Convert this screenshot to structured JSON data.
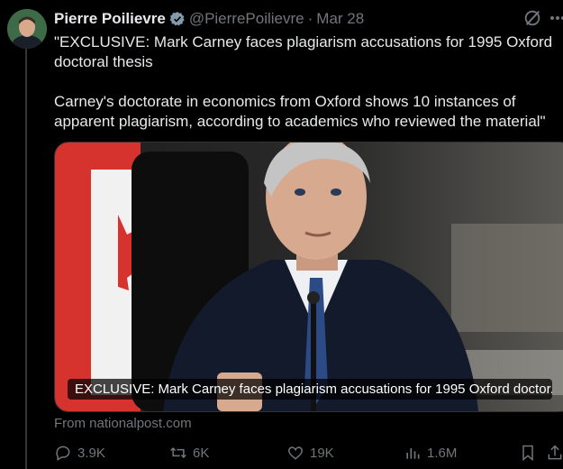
{
  "author": {
    "name": "Pierre Poilievre",
    "handle": "@PierrePoilievre",
    "separator": "·",
    "date": "Mar 28",
    "verified_color": "#829aab"
  },
  "tweet": {
    "paragraphs": [
      "\"EXCLUSIVE: Mark Carney faces plagiarism accusations for 1995 Oxford doctoral thesis",
      "Carney's doctorate in economics from Oxford shows 10 instances of apparent plagiarism, according to academics who reviewed the material\""
    ]
  },
  "card": {
    "caption": "EXCLUSIVE: Mark Carney faces plagiarism accusations for 1995 Oxford doctor...",
    "domain": "From nationalpost.com"
  },
  "actions": {
    "replies": "3.9K",
    "reposts": "6K",
    "likes": "19K",
    "views": "1.6M"
  },
  "icons": [
    "grok-icon",
    "more-icon",
    "verified-badge-icon",
    "reply-icon",
    "repost-icon",
    "like-icon",
    "views-icon",
    "bookmark-icon"
  ],
  "colors": {
    "background": "#000000",
    "text": "#e7e9ea",
    "muted": "#71767b"
  }
}
